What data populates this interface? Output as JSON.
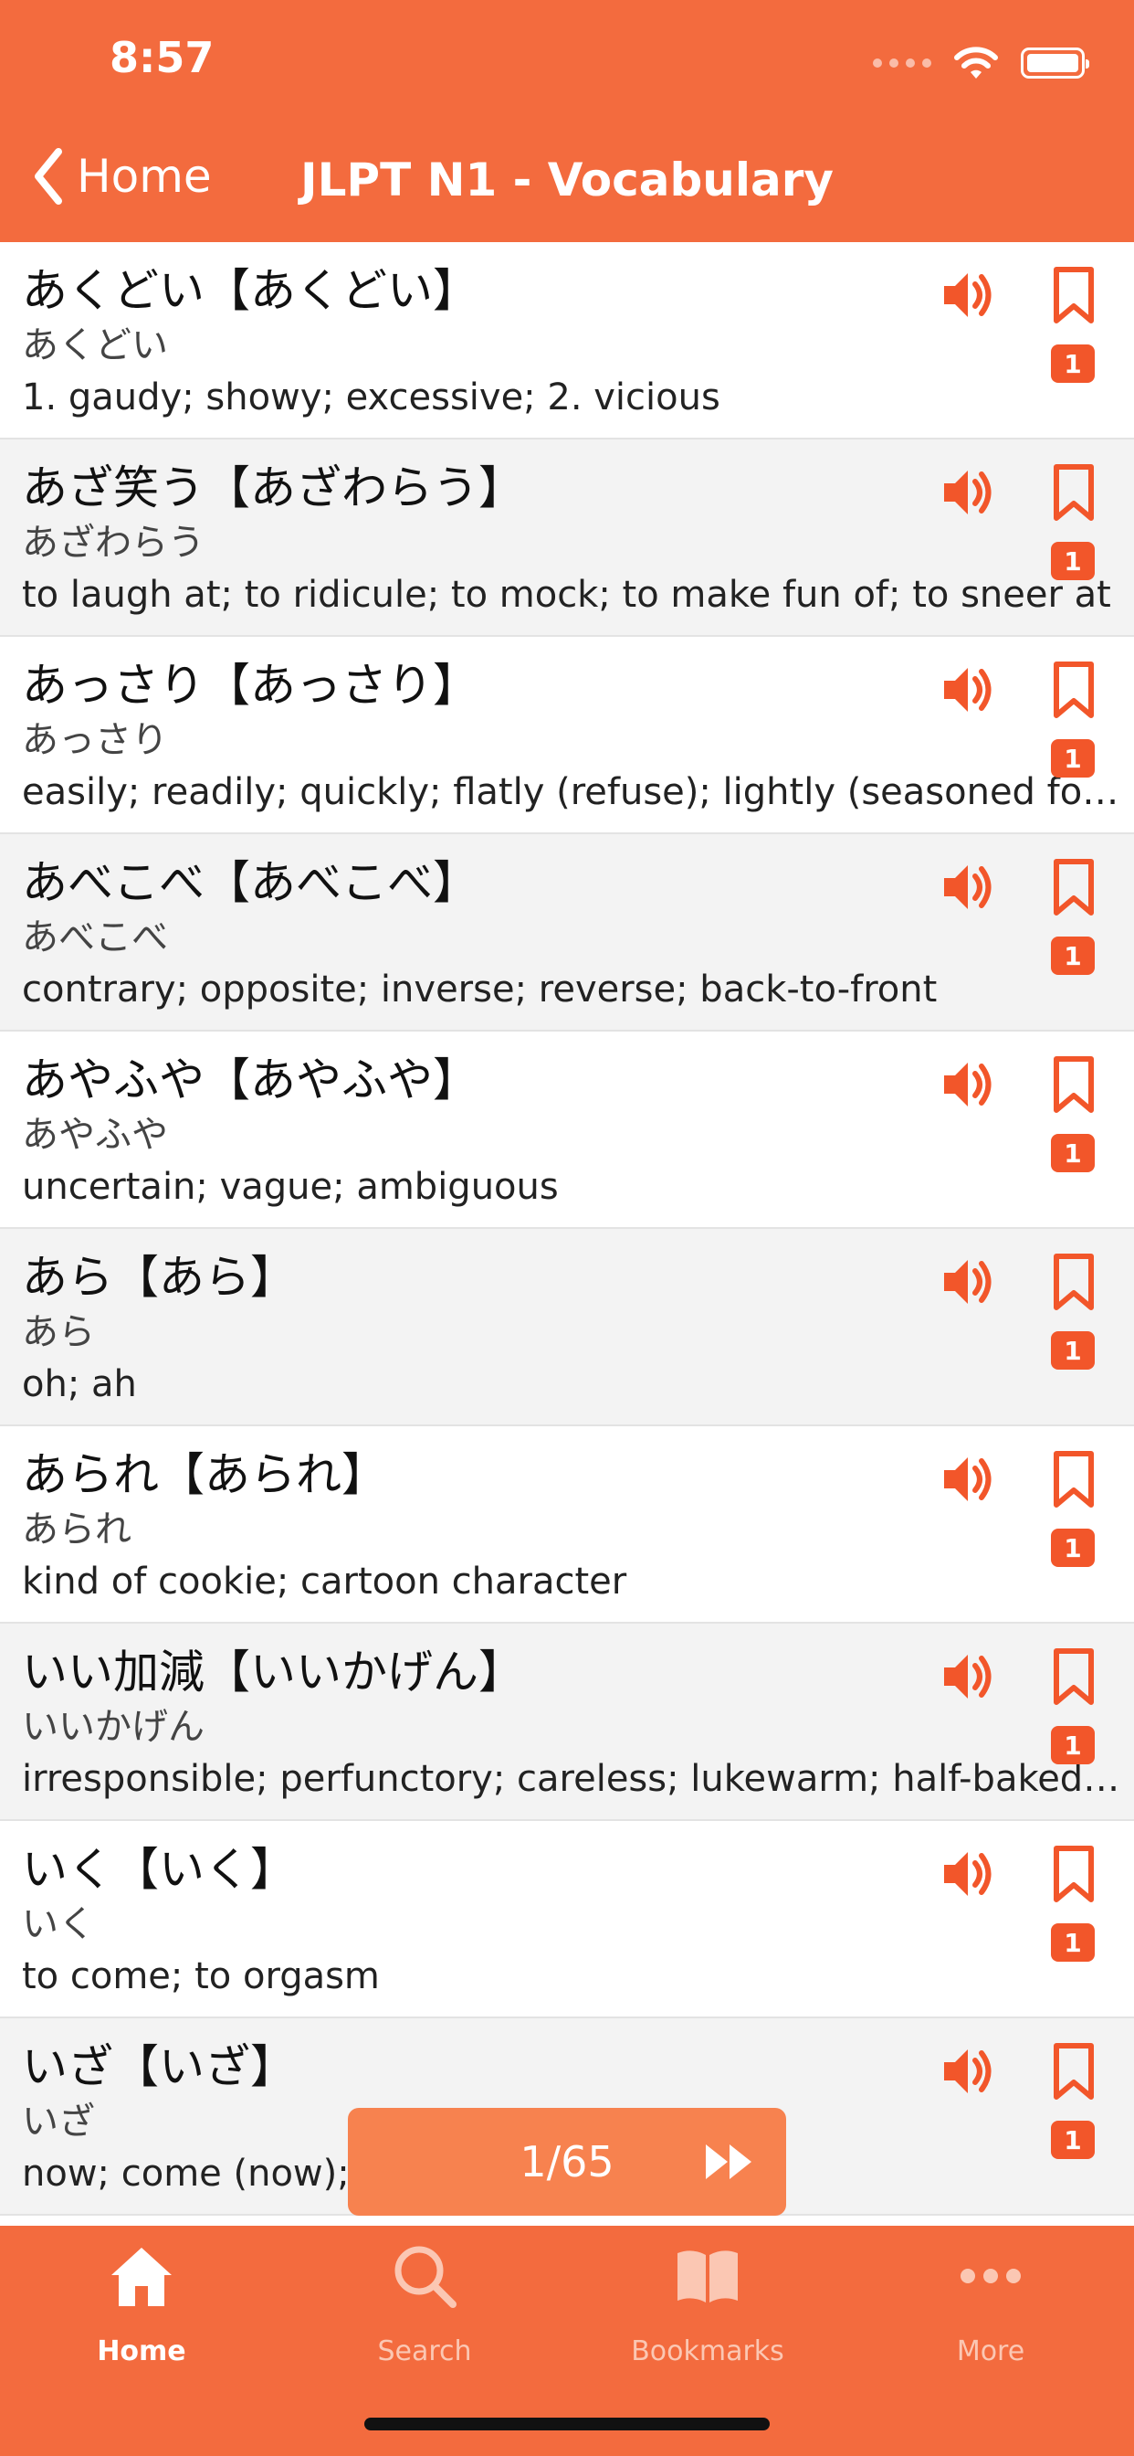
{
  "status_bar": {
    "time": "8:57"
  },
  "nav": {
    "back_label": "Home",
    "title": "JLPT N1 - Vocabulary"
  },
  "list": [
    {
      "title": "あくどい【あくどい】",
      "reading": "あくどい",
      "definition": "1. gaudy; showy; excessive; 2. vicious",
      "badge": "1"
    },
    {
      "title": "あざ笑う【あざわらう】",
      "reading": "あざわらう",
      "definition": "to laugh at; to ridicule; to mock; to make fun of; to sneer at",
      "badge": "1"
    },
    {
      "title": "あっさり【あっさり】",
      "reading": "あっさり",
      "definition": "easily; readily; quickly; flatly (refuse); lightly (seasoned food,...",
      "badge": "1"
    },
    {
      "title": "あべこべ【あべこべ】",
      "reading": "あべこべ",
      "definition": "contrary; opposite; inverse; reverse; back-to-front",
      "badge": "1"
    },
    {
      "title": "あやふや【あやふや】",
      "reading": "あやふや",
      "definition": "uncertain; vague; ambiguous",
      "badge": "1"
    },
    {
      "title": "あら【あら】",
      "reading": "あら",
      "definition": "oh; ah",
      "badge": "1"
    },
    {
      "title": "あられ【あられ】",
      "reading": "あられ",
      "definition": "kind of cookie; cartoon character",
      "badge": "1"
    },
    {
      "title": "いい加減【いいかげん】",
      "reading": "いいかげん",
      "definition": "irresponsible; perfunctory; careless; lukewarm; half-baked; h...",
      "badge": "1"
    },
    {
      "title": "いく【いく】",
      "reading": "いく",
      "definition": "to come; to orgasm",
      "badge": "1"
    },
    {
      "title": "いざ【いざ】",
      "reading": "いざ",
      "definition": "now; come (now);",
      "badge": "1"
    }
  ],
  "pager": {
    "text": "1/65",
    "icon": "fast-forward-icon"
  },
  "tabbar": [
    {
      "label": "Home",
      "icon": "home-icon",
      "active": true
    },
    {
      "label": "Search",
      "icon": "search-icon",
      "active": false
    },
    {
      "label": "Bookmarks",
      "icon": "book-icon",
      "active": false
    },
    {
      "label": "More",
      "icon": "more-icon",
      "active": false
    }
  ],
  "colors": {
    "accent": "#F36B3E",
    "badge": "#F2562A",
    "pager": "#F7824F"
  }
}
